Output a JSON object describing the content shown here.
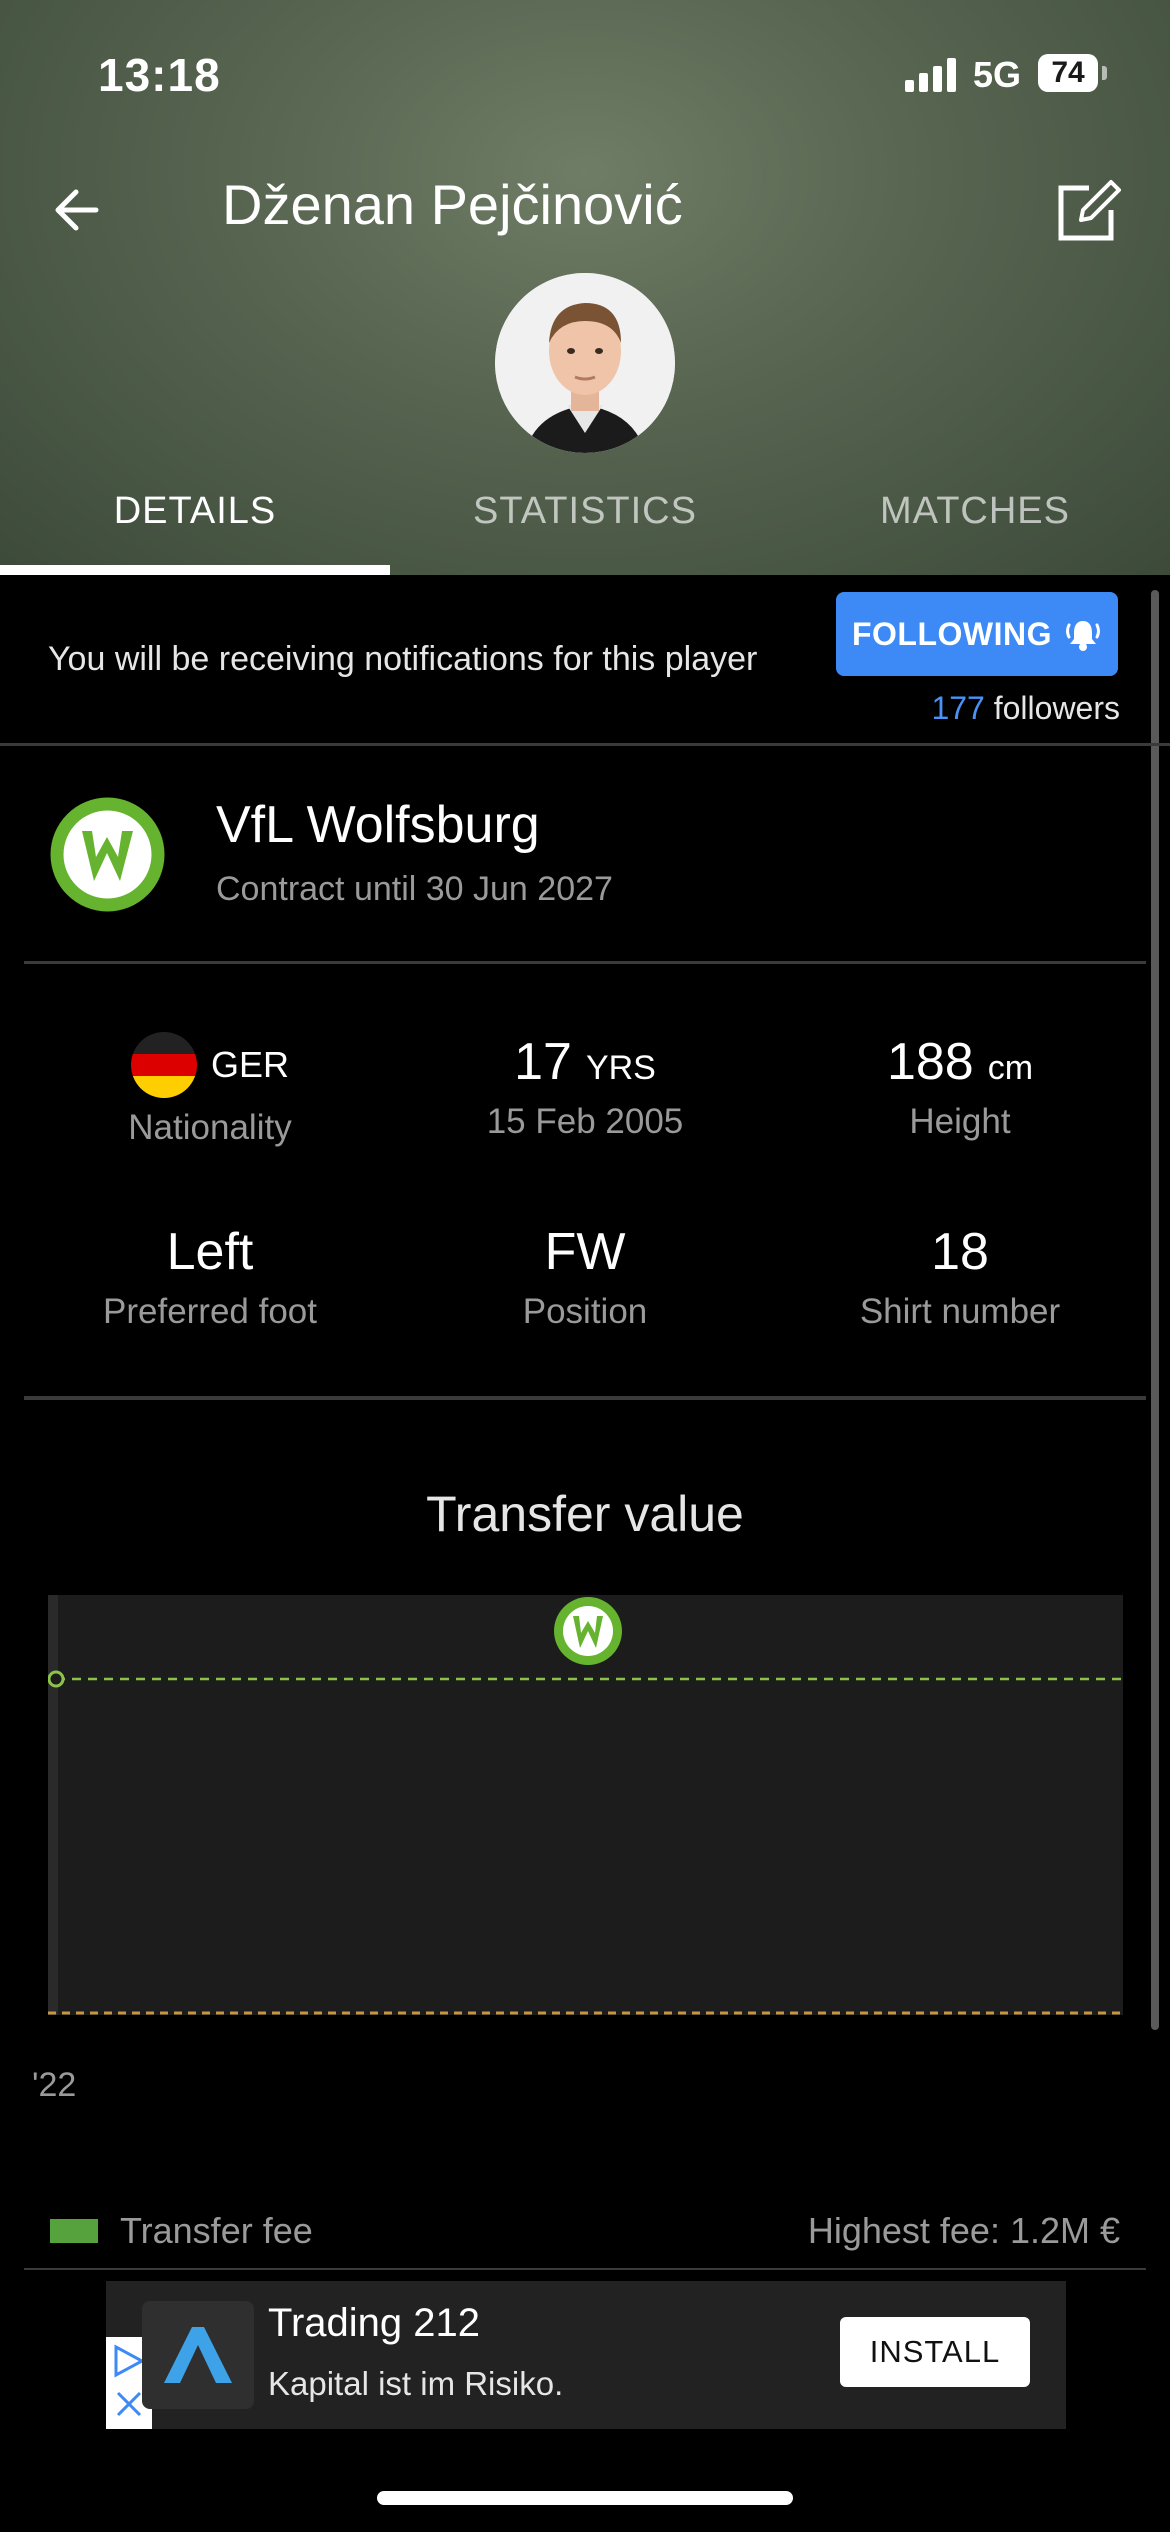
{
  "status_bar": {
    "time": "13:18",
    "network": "5G",
    "battery": "74"
  },
  "header": {
    "player_name": "Dženan Pejčinović"
  },
  "tabs": [
    {
      "label": "DETAILS",
      "active": true
    },
    {
      "label": "STATISTICS",
      "active": false
    },
    {
      "label": "MATCHES",
      "active": false
    }
  ],
  "notification": {
    "text": "You will be receiving notifications for this player",
    "button_label": "FOLLOWING",
    "followers_count": "177",
    "followers_label": "followers"
  },
  "club": {
    "name": "VfL Wolfsburg",
    "contract": "Contract until 30 Jun 2027"
  },
  "info": {
    "nationality": {
      "value": "GER",
      "label": "Nationality"
    },
    "age": {
      "value": "17",
      "unit": "YRS",
      "label": "15 Feb 2005"
    },
    "height": {
      "value": "188",
      "unit": "cm",
      "label": "Height"
    },
    "foot": {
      "value": "Left",
      "label": "Preferred foot"
    },
    "position": {
      "value": "FW",
      "label": "Position"
    },
    "shirt": {
      "value": "18",
      "label": "Shirt number"
    }
  },
  "chart_data": {
    "type": "line",
    "title": "Transfer value",
    "x_tick_labels": [
      "'22"
    ],
    "series": [
      {
        "name": "Transfer fee",
        "values": [
          1.2
        ]
      }
    ],
    "highest_fee": "Highest fee: 1.2M €",
    "colors": {
      "series": "#8bc34a",
      "baseline": "#c8963e",
      "background": "#1c1c1c"
    }
  },
  "legend": {
    "label": "Transfer fee",
    "highest": "Highest fee: 1.2M €"
  },
  "ad": {
    "title": "Trading 212",
    "subtitle": "Kapital ist im Risiko.",
    "button": "INSTALL"
  }
}
